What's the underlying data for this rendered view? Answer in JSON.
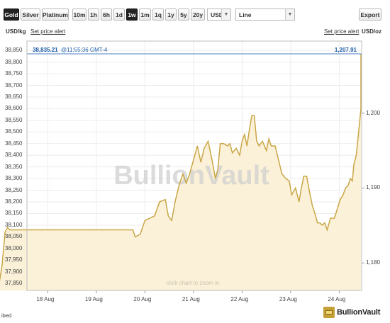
{
  "toolbar": {
    "metals": [
      {
        "label": "Gold",
        "active": true
      },
      {
        "label": "Silver",
        "active": false
      },
      {
        "label": "Platinum",
        "active": false
      }
    ],
    "periods": [
      {
        "label": "10m",
        "active": false
      },
      {
        "label": "1h",
        "active": false
      },
      {
        "label": "6h",
        "active": false
      },
      {
        "label": "1d",
        "active": false
      },
      {
        "label": "1w",
        "active": true
      },
      {
        "label": "1m",
        "active": false
      },
      {
        "label": "1q",
        "active": false
      },
      {
        "label": "1y",
        "active": false
      },
      {
        "label": "5y",
        "active": false
      },
      {
        "label": "20y",
        "active": false
      }
    ],
    "currency": "USD",
    "chart_style": "Line",
    "export_label": "Export"
  },
  "axis": {
    "left_unit": "USD/kg",
    "right_unit": "USD/oz",
    "set_alert_left": "Set price alert",
    "set_alert_right": "Set price alert"
  },
  "current_price": {
    "kg_value": "38,835.21",
    "time": "@11:55:36 GMT-4",
    "oz_value": "1,207.91"
  },
  "watermark": "BullionVault",
  "zoom_hint": "click chart to zoom in",
  "footnote": "ibed",
  "brand": "BullionVault",
  "colors": {
    "line": "#c9a646",
    "fill": "#fbf1d8",
    "current_line": "#4a7fc1",
    "current_text": "#1f5fa8"
  },
  "chart_data": {
    "type": "area",
    "ylabel_left": "USD/kg",
    "ylabel_right": "USD/oz",
    "ylim_left": [
      37820,
      38890
    ],
    "y_ticks_left": [
      "38,850",
      "38,800",
      "38,750",
      "38,700",
      "38,650",
      "38,600",
      "38,550",
      "38,500",
      "38,450",
      "38,400",
      "38,350",
      "38,300",
      "38,250",
      "38,200",
      "38,150",
      "38,100",
      "38,050",
      "38,000",
      "37,950",
      "37,900",
      "37,850"
    ],
    "y_ticks_right": [
      "1,200",
      "1,190",
      "1,180"
    ],
    "x_tick_labels": [
      "18 Aug",
      "19 Aug",
      "20 Aug",
      "21 Aug",
      "22 Aug",
      "23 Aug",
      "24 Aug"
    ],
    "grid": true,
    "series": [
      {
        "x": [
          17.0,
          17.06,
          17.12,
          17.17,
          17.22,
          17.3,
          17.4,
          17.6,
          18.0,
          18.4,
          18.8,
          19.2,
          19.6,
          19.75,
          19.8,
          19.9,
          20.0,
          20.1,
          20.2,
          20.3,
          20.42,
          20.48,
          20.55,
          20.62,
          20.7,
          20.78,
          20.85,
          20.92,
          21.0,
          21.08,
          21.15,
          21.22,
          21.3,
          21.38,
          21.45,
          21.5,
          21.55,
          21.62,
          21.7,
          21.75,
          21.8,
          21.88,
          21.95,
          22.0,
          22.05,
          22.1,
          22.15,
          22.2,
          22.25,
          22.3,
          22.35,
          22.42,
          22.5,
          22.55,
          22.6,
          22.68,
          22.75,
          22.82,
          22.9,
          22.97,
          23.02,
          23.1,
          23.17,
          23.22,
          23.27,
          23.33,
          23.4,
          23.45,
          23.5,
          23.55,
          23.6,
          23.65,
          23.7,
          23.75,
          23.82,
          23.9,
          23.96,
          24.02,
          24.08,
          24.13,
          24.18,
          24.23,
          24.27,
          24.3,
          24.35,
          24.4,
          24.45,
          24.5,
          24.55,
          24.58,
          24.6,
          24.65,
          24.7,
          24.75,
          24.8,
          24.88
        ],
        "values": [
          37850,
          37930,
          38070,
          38090,
          38080,
          38080,
          38080,
          38080,
          38080,
          38080,
          38080,
          38080,
          38080,
          38080,
          38050,
          38060,
          38120,
          38130,
          38140,
          38200,
          38210,
          38140,
          38120,
          38200,
          38270,
          38320,
          38280,
          38320,
          38380,
          38440,
          38370,
          38430,
          38460,
          38380,
          38300,
          38340,
          38450,
          38450,
          38440,
          38450,
          38410,
          38430,
          38400,
          38460,
          38490,
          38440,
          38510,
          38570,
          38570,
          38460,
          38440,
          38460,
          38420,
          38470,
          38440,
          38440,
          38380,
          38320,
          38300,
          38290,
          38230,
          38260,
          38200,
          38260,
          38310,
          38310,
          38230,
          38180,
          38150,
          38110,
          38110,
          38100,
          38110,
          38080,
          38130,
          38130,
          38170,
          38210,
          38230,
          38260,
          38270,
          38300,
          38290,
          38360,
          38400,
          38500,
          38600,
          38700,
          38780,
          38820,
          38835,
          38835,
          38835,
          38835,
          38835,
          38835
        ]
      }
    ]
  }
}
